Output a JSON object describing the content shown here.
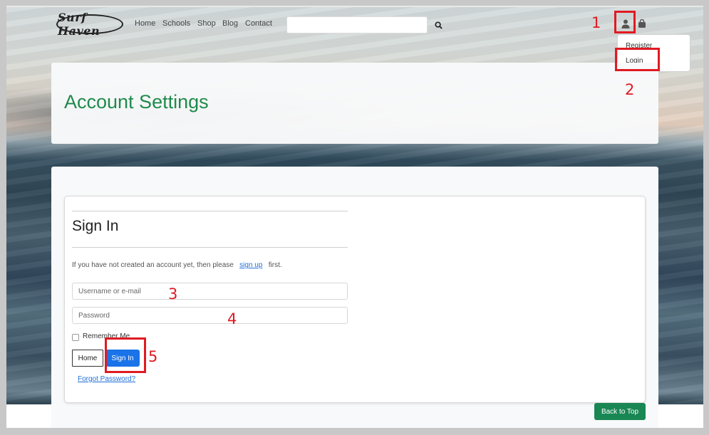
{
  "navbar": {
    "logo_text": "Surf Haven",
    "links": [
      "Home",
      "Schools",
      "Shop",
      "Blog",
      "Contact"
    ],
    "search_placeholder": "",
    "user_menu": {
      "items": [
        "Register",
        "Login"
      ]
    }
  },
  "page": {
    "title": "Account Settings"
  },
  "signin": {
    "title": "Sign In",
    "help_prefix": "If you have not created an account yet, then please",
    "help_link": "sign up",
    "help_suffix": "first.",
    "username_placeholder": "Username or e-mail",
    "password_placeholder": "Password",
    "remember_label": "Remember Me",
    "home_button": "Home",
    "signin_button": "Sign In",
    "forgot_link": "Forgot Password?"
  },
  "back_to_top": "Back to Top",
  "annotations": {
    "labels": [
      "1",
      "2",
      "3",
      "4",
      "5"
    ],
    "color": "#e01a22"
  },
  "colors": {
    "title_green": "#1f8a4c",
    "primary_blue": "#1a73e8",
    "success_green": "#198754"
  },
  "icons": {
    "search": "search-icon",
    "user": "user-icon",
    "bag": "shopping-bag-icon"
  }
}
